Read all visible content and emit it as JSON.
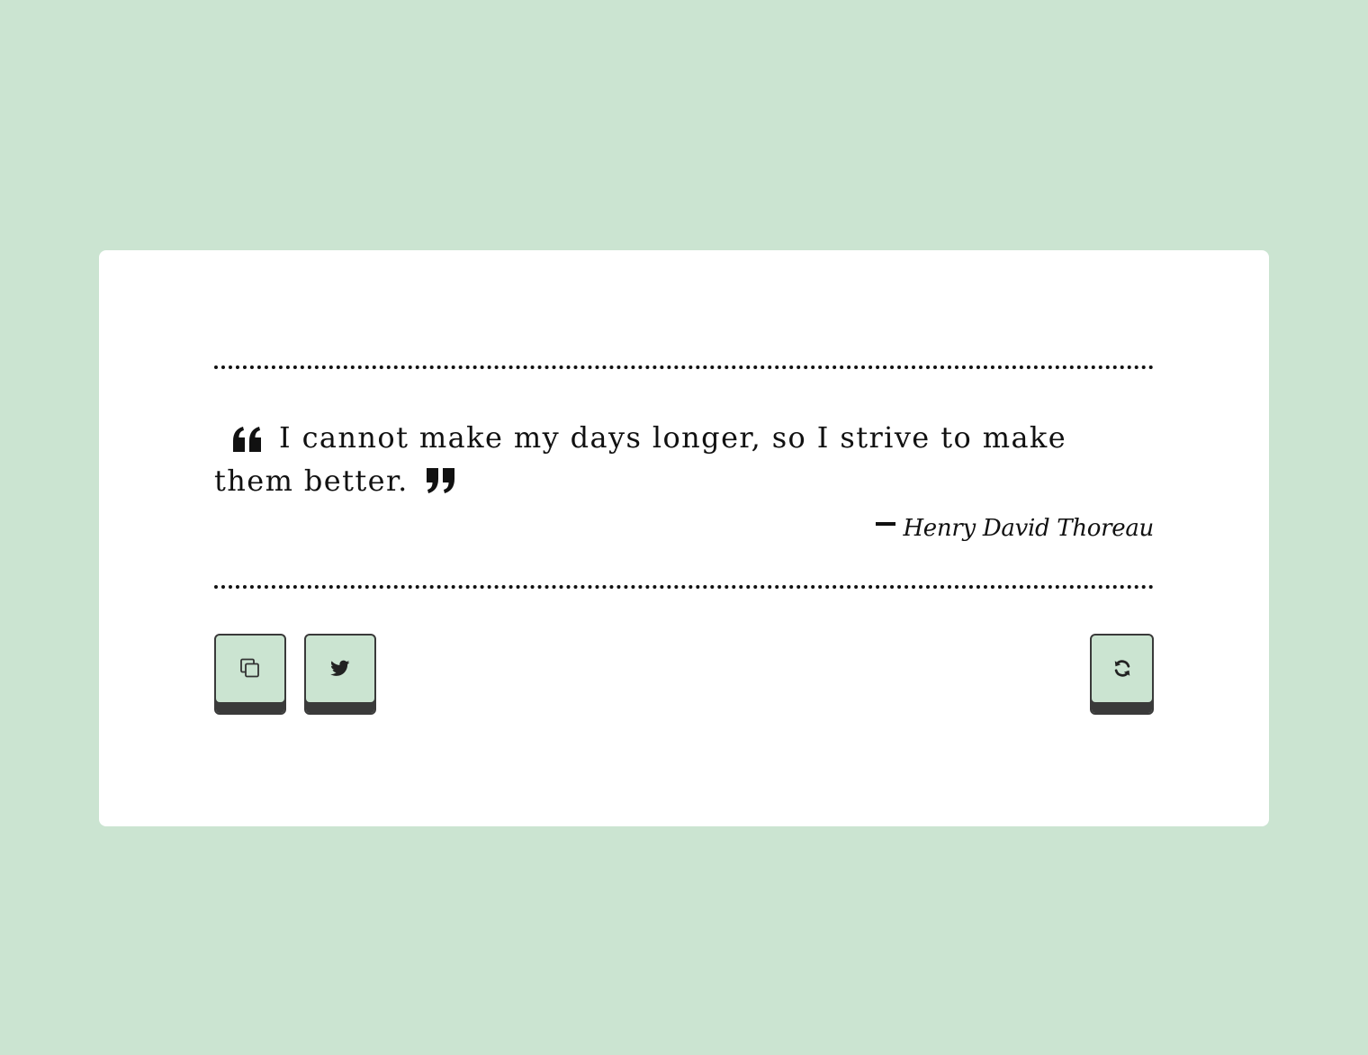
{
  "quote": {
    "text": "I cannot make my days longer, so I strive to make them better.",
    "author": "Henry David Thoreau"
  },
  "icons": {
    "open_quote": "quote-left-icon",
    "close_quote": "quote-right-icon",
    "copy": "copy-icon",
    "tweet": "twitter-icon",
    "refresh": "refresh-icon"
  },
  "colors": {
    "background": "#cbe4d1",
    "card": "#ffffff",
    "text": "#111111",
    "button_fill": "#cbe4d1",
    "button_border": "#3a3a3a"
  }
}
